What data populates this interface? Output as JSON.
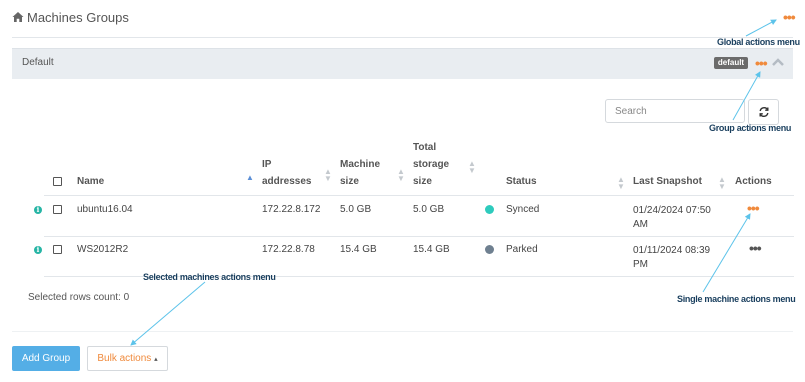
{
  "header": {
    "title": "Machines Groups",
    "home_icon": "home-icon",
    "global_menu_icon": "ellipsis-icon"
  },
  "group": {
    "name": "Default",
    "badge": "default",
    "collapse_icon": "chevron-up-icon"
  },
  "search": {
    "placeholder": "Search",
    "value": ""
  },
  "refresh_icon": "refresh-icon",
  "table": {
    "columns": {
      "name": "Name",
      "ip": [
        "IP",
        "addresses"
      ],
      "machine_size": [
        "Machine",
        "size"
      ],
      "total_storage": [
        "Total",
        "storage",
        "size"
      ],
      "status": "Status",
      "last_snapshot": "Last Snapshot",
      "actions": "Actions"
    },
    "rows": [
      {
        "name": "ubuntu16.04",
        "ip": "172.22.8.172",
        "machine_size": "5.0 GB",
        "total_storage": "5.0 GB",
        "status": "Synced",
        "status_color": "#2ecbbd",
        "snapshot_date": "01/24/2024 07:50",
        "snapshot_ampm": "AM",
        "actions_icon": "ellipsis-icon"
      },
      {
        "name": "WS2012R2",
        "ip": "172.22.8.78",
        "machine_size": "15.4 GB",
        "total_storage": "15.4 GB",
        "status": "Parked",
        "status_color": "#6f8090",
        "snapshot_date": "01/11/2024 08:39",
        "snapshot_ampm": "PM",
        "actions_icon": "ellipsis-icon"
      }
    ],
    "info_glyph": "i"
  },
  "selected_rows_label": "Selected rows count: 0",
  "buttons": {
    "add_group": "Add Group",
    "bulk_actions": "Bulk actions",
    "bulk_caret": "▴"
  },
  "callouts": {
    "global": "Global actions menu",
    "group": "Group actions menu",
    "selected": "Selected machines actions menu",
    "single": "Single machine actions menu"
  },
  "colors": {
    "accent_orange": "#f08a3c",
    "primary_blue": "#54aee6",
    "callout_arrow": "#5cc3ea",
    "callout_text": "#1a3f5e"
  }
}
